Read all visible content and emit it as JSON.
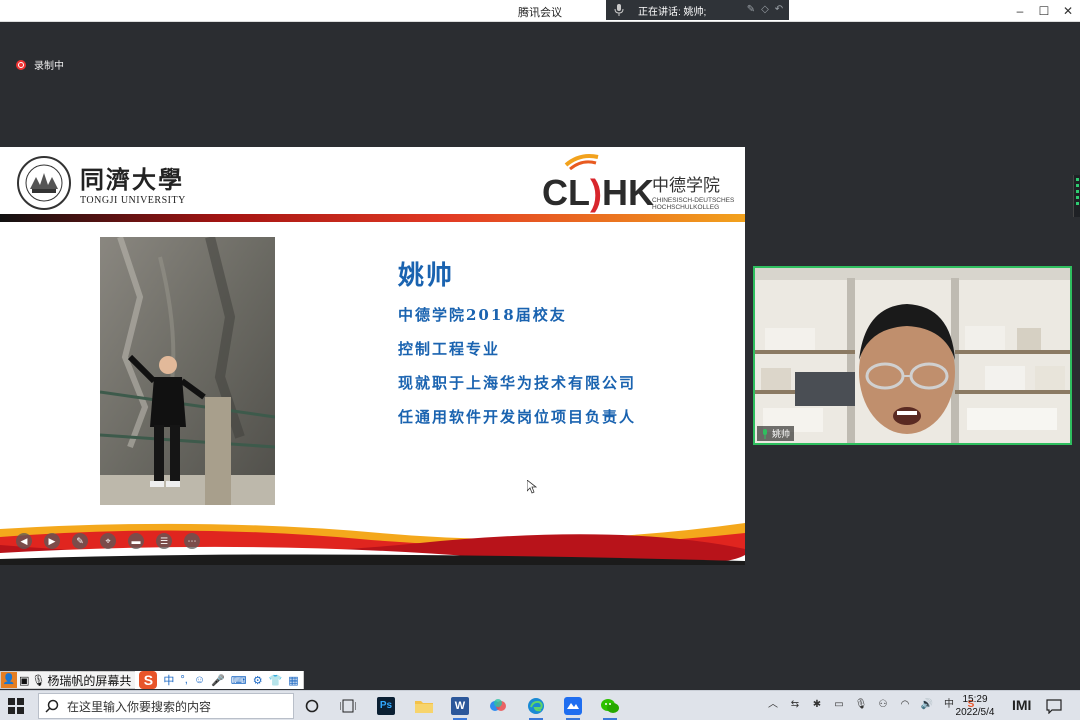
{
  "app": {
    "title": "腾讯会议",
    "speaking_label": "正在讲话: 姚帅;"
  },
  "recording": {
    "label": "录制中"
  },
  "slide": {
    "tongji_cn": "同濟大學",
    "tongji_en": "TONGJI UNIVERSITY",
    "cdhk_mark": "CDHK",
    "cdhk_cn": "中德学院",
    "cdhk_de1": "CHINESISCH-DEUTSCHES",
    "cdhk_de2": "HOCHSCHULKOLLEG",
    "person_name": "姚帅",
    "lines": [
      "中德学院2018届校友",
      "控制工程专业",
      "现就职于上海华为技术有限公司",
      "任通用软件开发岗位项目负责人"
    ]
  },
  "video_tile": {
    "name": "姚帅"
  },
  "share_bar": {
    "presenter": "杨瑞帆的屏幕共",
    "ime_mode": "中"
  },
  "taskbar": {
    "search_placeholder": "在这里输入你要搜索的内容",
    "time": "15:29",
    "date": "2022/5/4",
    "apps": [
      "cortana-icon",
      "task-view-icon",
      "photoshop-icon",
      "file-explorer-icon",
      "word-icon",
      "baidu-netdisk-icon",
      "edge-icon",
      "tencent-meeting-icon",
      "wechat-icon"
    ]
  },
  "colors": {
    "slide_blue": "#1a63b0",
    "active_speaker": "#2fbf5f",
    "record_red": "#e33333",
    "cdhk_red": "#d8262c",
    "cdhk_orange": "#f2a21d"
  }
}
